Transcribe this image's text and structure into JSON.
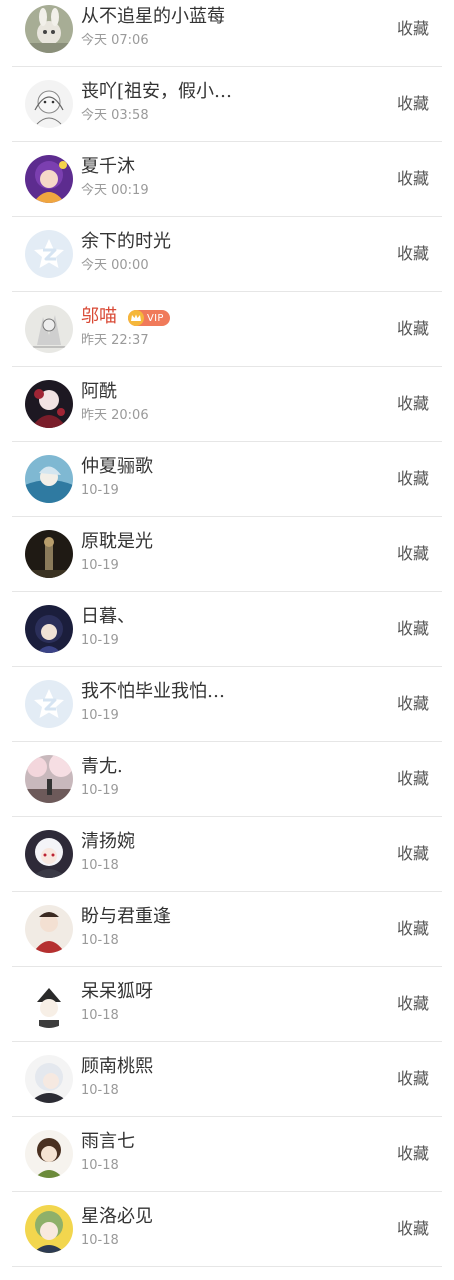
{
  "fav_label": "收藏",
  "vip": {
    "text": "VIP",
    "color": "#f07a5a"
  },
  "rows": [
    {
      "name": "从不追星的小蓝莓",
      "time": "今天 07:06",
      "avatar": "bunny-avatar"
    },
    {
      "name": "丧吖[祖安，假小…",
      "time": "今天 03:58",
      "avatar": "sketch-girl-avatar"
    },
    {
      "name": "夏千沐",
      "time": "今天 00:19",
      "avatar": "purple-anime-avatar"
    },
    {
      "name": "余下的时光",
      "time": "今天 00:00",
      "avatar": "qzone-default-avatar"
    },
    {
      "name": "邬喵",
      "time": "昨天 22:37",
      "avatar": "ink-sketch-avatar",
      "vip": true
    },
    {
      "name": "阿酰",
      "time": "昨天 20:06",
      "avatar": "dark-red-avatar"
    },
    {
      "name": "仲夏骊歌",
      "time": "10-19",
      "avatar": "blue-girl-avatar"
    },
    {
      "name": "原耽是光",
      "time": "10-19",
      "avatar": "dark-figure-avatar"
    },
    {
      "name": "日暮、",
      "time": "10-19",
      "avatar": "navy-anime-avatar"
    },
    {
      "name": "我不怕毕业我怕…",
      "time": "10-19",
      "avatar": "qzone-default-avatar"
    },
    {
      "name": "青尢.",
      "time": "10-19",
      "avatar": "sakura-avatar"
    },
    {
      "name": "清扬婉",
      "time": "10-18",
      "avatar": "white-hair-avatar"
    },
    {
      "name": "盼与君重逢",
      "time": "10-18",
      "avatar": "red-hanfu-avatar"
    },
    {
      "name": "呆呆狐呀",
      "time": "10-18",
      "avatar": "chibi-avatar"
    },
    {
      "name": "顾南桃熙",
      "time": "10-18",
      "avatar": "silver-hair-avatar"
    },
    {
      "name": "雨言七",
      "time": "10-18",
      "avatar": "brown-hair-avatar"
    },
    {
      "name": "星洛必见",
      "time": "10-18",
      "avatar": "green-hair-avatar"
    }
  ]
}
